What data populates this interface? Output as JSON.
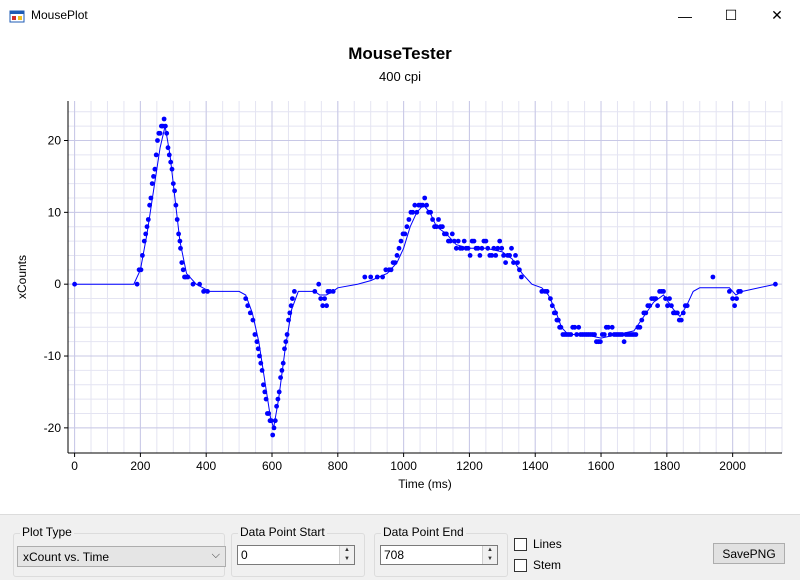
{
  "window": {
    "title": "MousePlot",
    "minimize": "—",
    "maximize": "☐",
    "close": "✕"
  },
  "chart_data": {
    "type": "scatter",
    "title": "MouseTester",
    "subtitle": "400 cpi",
    "xlabel": "Time (ms)",
    "ylabel": "xCounts",
    "xlim": [
      -20,
      2150
    ],
    "ylim": [
      -23.5,
      25.5
    ],
    "xticks": [
      0,
      200,
      400,
      600,
      800,
      1000,
      1200,
      1400,
      1600,
      1800,
      2000
    ],
    "yticks": [
      -20,
      -10,
      0,
      10,
      20
    ],
    "grid": true,
    "series": [
      {
        "color": "#0000ff",
        "points": [
          [
            0,
            0
          ],
          [
            190,
            0
          ],
          [
            196,
            2
          ],
          [
            202,
            2
          ],
          [
            206,
            4
          ],
          [
            212,
            6
          ],
          [
            216,
            7
          ],
          [
            220,
            8
          ],
          [
            224,
            9
          ],
          [
            228,
            11
          ],
          [
            232,
            12
          ],
          [
            236,
            14
          ],
          [
            240,
            15
          ],
          [
            244,
            16
          ],
          [
            248,
            18
          ],
          [
            252,
            20
          ],
          [
            256,
            21
          ],
          [
            260,
            21
          ],
          [
            264,
            22
          ],
          [
            268,
            22
          ],
          [
            272,
            23
          ],
          [
            276,
            22
          ],
          [
            280,
            21
          ],
          [
            284,
            19
          ],
          [
            288,
            18
          ],
          [
            292,
            17
          ],
          [
            296,
            16
          ],
          [
            300,
            14
          ],
          [
            304,
            13
          ],
          [
            308,
            11
          ],
          [
            312,
            9
          ],
          [
            316,
            7
          ],
          [
            320,
            6
          ],
          [
            322,
            5
          ],
          [
            326,
            3
          ],
          [
            330,
            2
          ],
          [
            334,
            1
          ],
          [
            338,
            1
          ],
          [
            344,
            1
          ],
          [
            360,
            0
          ],
          [
            380,
            0
          ],
          [
            392,
            -1
          ],
          [
            404,
            -1
          ],
          [
            520,
            -2
          ],
          [
            526,
            -3
          ],
          [
            534,
            -4
          ],
          [
            542,
            -5
          ],
          [
            548,
            -7
          ],
          [
            554,
            -8
          ],
          [
            558,
            -9
          ],
          [
            562,
            -10
          ],
          [
            566,
            -11
          ],
          [
            570,
            -12
          ],
          [
            574,
            -14
          ],
          [
            578,
            -15
          ],
          [
            582,
            -16
          ],
          [
            586,
            -18
          ],
          [
            590,
            -18
          ],
          [
            594,
            -19
          ],
          [
            598,
            -19
          ],
          [
            602,
            -21
          ],
          [
            606,
            -20
          ],
          [
            610,
            -19
          ],
          [
            614,
            -17
          ],
          [
            618,
            -16
          ],
          [
            622,
            -15
          ],
          [
            626,
            -13
          ],
          [
            630,
            -12
          ],
          [
            634,
            -11
          ],
          [
            638,
            -9
          ],
          [
            642,
            -8
          ],
          [
            646,
            -7
          ],
          [
            650,
            -5
          ],
          [
            654,
            -4
          ],
          [
            658,
            -3
          ],
          [
            662,
            -2
          ],
          [
            668,
            -1
          ],
          [
            730,
            -1
          ],
          [
            742,
            0
          ],
          [
            748,
            -2
          ],
          [
            754,
            -3
          ],
          [
            760,
            -2
          ],
          [
            766,
            -3
          ],
          [
            770,
            -1
          ],
          [
            776,
            -1
          ],
          [
            786,
            -1
          ],
          [
            882,
            1
          ],
          [
            900,
            1
          ],
          [
            920,
            1
          ],
          [
            936,
            1
          ],
          [
            946,
            2
          ],
          [
            956,
            2
          ],
          [
            962,
            2
          ],
          [
            968,
            3
          ],
          [
            974,
            3
          ],
          [
            980,
            4
          ],
          [
            986,
            5
          ],
          [
            992,
            6
          ],
          [
            998,
            7
          ],
          [
            1004,
            7
          ],
          [
            1010,
            8
          ],
          [
            1016,
            9
          ],
          [
            1022,
            10
          ],
          [
            1028,
            10
          ],
          [
            1034,
            11
          ],
          [
            1040,
            10
          ],
          [
            1046,
            11
          ],
          [
            1052,
            11
          ],
          [
            1058,
            11
          ],
          [
            1064,
            12
          ],
          [
            1070,
            11
          ],
          [
            1076,
            10
          ],
          [
            1082,
            10
          ],
          [
            1088,
            9
          ],
          [
            1094,
            8
          ],
          [
            1100,
            8
          ],
          [
            1106,
            9
          ],
          [
            1112,
            8
          ],
          [
            1118,
            8
          ],
          [
            1124,
            7
          ],
          [
            1130,
            7
          ],
          [
            1136,
            6
          ],
          [
            1142,
            6
          ],
          [
            1148,
            7
          ],
          [
            1154,
            6
          ],
          [
            1160,
            5
          ],
          [
            1166,
            6
          ],
          [
            1172,
            5
          ],
          [
            1178,
            5
          ],
          [
            1184,
            6
          ],
          [
            1190,
            5
          ],
          [
            1196,
            5
          ],
          [
            1202,
            4
          ],
          [
            1208,
            6
          ],
          [
            1214,
            6
          ],
          [
            1220,
            5
          ],
          [
            1226,
            5
          ],
          [
            1232,
            4
          ],
          [
            1238,
            5
          ],
          [
            1244,
            6
          ],
          [
            1250,
            6
          ],
          [
            1256,
            5
          ],
          [
            1262,
            4
          ],
          [
            1268,
            4
          ],
          [
            1274,
            5
          ],
          [
            1280,
            4
          ],
          [
            1286,
            5
          ],
          [
            1292,
            6
          ],
          [
            1298,
            5
          ],
          [
            1304,
            4
          ],
          [
            1310,
            3
          ],
          [
            1316,
            4
          ],
          [
            1322,
            4
          ],
          [
            1328,
            5
          ],
          [
            1334,
            3
          ],
          [
            1340,
            4
          ],
          [
            1346,
            3
          ],
          [
            1352,
            2
          ],
          [
            1358,
            1
          ],
          [
            1420,
            -1
          ],
          [
            1430,
            -1
          ],
          [
            1436,
            -1
          ],
          [
            1446,
            -2
          ],
          [
            1452,
            -3
          ],
          [
            1458,
            -4
          ],
          [
            1462,
            -4
          ],
          [
            1466,
            -5
          ],
          [
            1470,
            -5
          ],
          [
            1474,
            -6
          ],
          [
            1478,
            -6
          ],
          [
            1484,
            -7
          ],
          [
            1490,
            -7
          ],
          [
            1496,
            -7
          ],
          [
            1502,
            -7
          ],
          [
            1508,
            -7
          ],
          [
            1514,
            -6
          ],
          [
            1520,
            -6
          ],
          [
            1526,
            -7
          ],
          [
            1532,
            -6
          ],
          [
            1538,
            -7
          ],
          [
            1544,
            -7
          ],
          [
            1550,
            -7
          ],
          [
            1556,
            -7
          ],
          [
            1562,
            -7
          ],
          [
            1568,
            -7
          ],
          [
            1574,
            -7
          ],
          [
            1580,
            -7
          ],
          [
            1586,
            -8
          ],
          [
            1592,
            -8
          ],
          [
            1598,
            -8
          ],
          [
            1604,
            -7
          ],
          [
            1610,
            -7
          ],
          [
            1616,
            -6
          ],
          [
            1622,
            -6
          ],
          [
            1628,
            -7
          ],
          [
            1634,
            -6
          ],
          [
            1640,
            -7
          ],
          [
            1646,
            -7
          ],
          [
            1652,
            -7
          ],
          [
            1658,
            -7
          ],
          [
            1664,
            -7
          ],
          [
            1670,
            -8
          ],
          [
            1676,
            -7
          ],
          [
            1682,
            -7
          ],
          [
            1688,
            -7
          ],
          [
            1694,
            -7
          ],
          [
            1700,
            -7
          ],
          [
            1706,
            -7
          ],
          [
            1712,
            -6
          ],
          [
            1718,
            -6
          ],
          [
            1724,
            -5
          ],
          [
            1730,
            -4
          ],
          [
            1736,
            -4
          ],
          [
            1742,
            -3
          ],
          [
            1748,
            -3
          ],
          [
            1754,
            -2
          ],
          [
            1760,
            -2
          ],
          [
            1766,
            -2
          ],
          [
            1772,
            -3
          ],
          [
            1778,
            -1
          ],
          [
            1784,
            -1
          ],
          [
            1790,
            -1
          ],
          [
            1796,
            -2
          ],
          [
            1802,
            -3
          ],
          [
            1808,
            -2
          ],
          [
            1814,
            -3
          ],
          [
            1820,
            -4
          ],
          [
            1826,
            -4
          ],
          [
            1832,
            -4
          ],
          [
            1838,
            -5
          ],
          [
            1844,
            -5
          ],
          [
            1850,
            -4
          ],
          [
            1856,
            -3
          ],
          [
            1862,
            -3
          ],
          [
            1940,
            1
          ],
          [
            1990,
            -1
          ],
          [
            2000,
            -2
          ],
          [
            2006,
            -3
          ],
          [
            2012,
            -2
          ],
          [
            2018,
            -1
          ],
          [
            2024,
            -1
          ],
          [
            2130,
            0
          ]
        ],
        "fit": [
          [
            0,
            0
          ],
          [
            180,
            0
          ],
          [
            200,
            2
          ],
          [
            220,
            7
          ],
          [
            240,
            13
          ],
          [
            260,
            19
          ],
          [
            275,
            22
          ],
          [
            290,
            18
          ],
          [
            305,
            12
          ],
          [
            320,
            6
          ],
          [
            340,
            1.5
          ],
          [
            370,
            0
          ],
          [
            410,
            -1
          ],
          [
            500,
            -1
          ],
          [
            520,
            -1.5
          ],
          [
            540,
            -4
          ],
          [
            560,
            -8
          ],
          [
            580,
            -14
          ],
          [
            595,
            -18.5
          ],
          [
            605,
            -20
          ],
          [
            620,
            -16
          ],
          [
            640,
            -9
          ],
          [
            660,
            -3.5
          ],
          [
            680,
            -1
          ],
          [
            730,
            -1
          ],
          [
            745,
            -1.5
          ],
          [
            765,
            -1.5
          ],
          [
            785,
            -1
          ],
          [
            800,
            -0.5
          ],
          [
            860,
            0
          ],
          [
            900,
            0.5
          ],
          [
            950,
            1.5
          ],
          [
            980,
            3
          ],
          [
            1000,
            5
          ],
          [
            1020,
            8
          ],
          [
            1040,
            10
          ],
          [
            1060,
            11
          ],
          [
            1080,
            10
          ],
          [
            1100,
            8
          ],
          [
            1130,
            7
          ],
          [
            1160,
            5.5
          ],
          [
            1200,
            5
          ],
          [
            1250,
            5
          ],
          [
            1300,
            4.5
          ],
          [
            1330,
            3.5
          ],
          [
            1360,
            1.5
          ],
          [
            1390,
            0
          ],
          [
            1420,
            -0.5
          ],
          [
            1440,
            -1.5
          ],
          [
            1460,
            -3.5
          ],
          [
            1480,
            -6
          ],
          [
            1500,
            -7
          ],
          [
            1550,
            -7
          ],
          [
            1600,
            -7.5
          ],
          [
            1650,
            -7
          ],
          [
            1700,
            -6.5
          ],
          [
            1730,
            -4.5
          ],
          [
            1760,
            -2.5
          ],
          [
            1790,
            -1.5
          ],
          [
            1820,
            -3.5
          ],
          [
            1840,
            -4.5
          ],
          [
            1860,
            -3
          ],
          [
            1880,
            -1
          ],
          [
            1900,
            -0.5
          ],
          [
            1950,
            -0.5
          ],
          [
            1990,
            -0.5
          ],
          [
            2010,
            -1.5
          ],
          [
            2030,
            -1
          ],
          [
            2130,
            0
          ]
        ]
      }
    ]
  },
  "controls": {
    "plot_type": {
      "label": "Plot Type",
      "value": "xCount vs. Time",
      "chev": "⌵"
    },
    "start": {
      "label": "Data Point Start",
      "value": "0"
    },
    "end": {
      "label": "Data Point End",
      "value": "708"
    },
    "lines_label": "Lines",
    "stem_label": "Stem",
    "save_label": "SavePNG"
  },
  "colors": {
    "marker": "#0000ff",
    "grid_major": "#c8c8e6",
    "grid_minor": "#e4e4f2",
    "panel": "#f0f0f0"
  }
}
